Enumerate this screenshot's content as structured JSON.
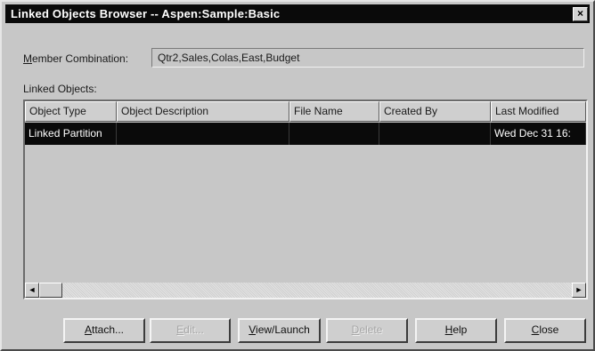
{
  "window": {
    "title": "Linked Objects Browser  -- Aspen:Sample:Basic",
    "close_glyph": "×"
  },
  "member_combination": {
    "label_pre": "",
    "label_mnemonic": "M",
    "label_post": "ember Combination:",
    "value": "Qtr2,Sales,Colas,East,Budget"
  },
  "linked_objects": {
    "label": "Linked Objects:",
    "columns": [
      "Object Type",
      "Object Description",
      "File Name",
      "Created By",
      "Last Modified"
    ],
    "rows": [
      [
        "Linked Partition",
        "",
        "",
        "",
        "Wed Dec 31 16:"
      ]
    ],
    "scrollbar": {
      "left_arrow": "◄",
      "right_arrow": "►"
    }
  },
  "buttons": {
    "attach": {
      "mnemonic": "A",
      "rest": "ttach..."
    },
    "edit": {
      "mnemonic": "E",
      "rest": "dit..."
    },
    "view_launch": {
      "mnemonic": "V",
      "rest": "iew/Launch"
    },
    "delete": {
      "mnemonic": "D",
      "rest": "elete"
    },
    "help": {
      "mnemonic": "H",
      "rest": "elp"
    },
    "close": {
      "mnemonic": "C",
      "rest": "lose"
    }
  },
  "colors": {
    "titlebar_bg": "#0a0a0a",
    "dialog_bg": "#c7c7c7",
    "selection_bg": "#0a0a0a"
  }
}
